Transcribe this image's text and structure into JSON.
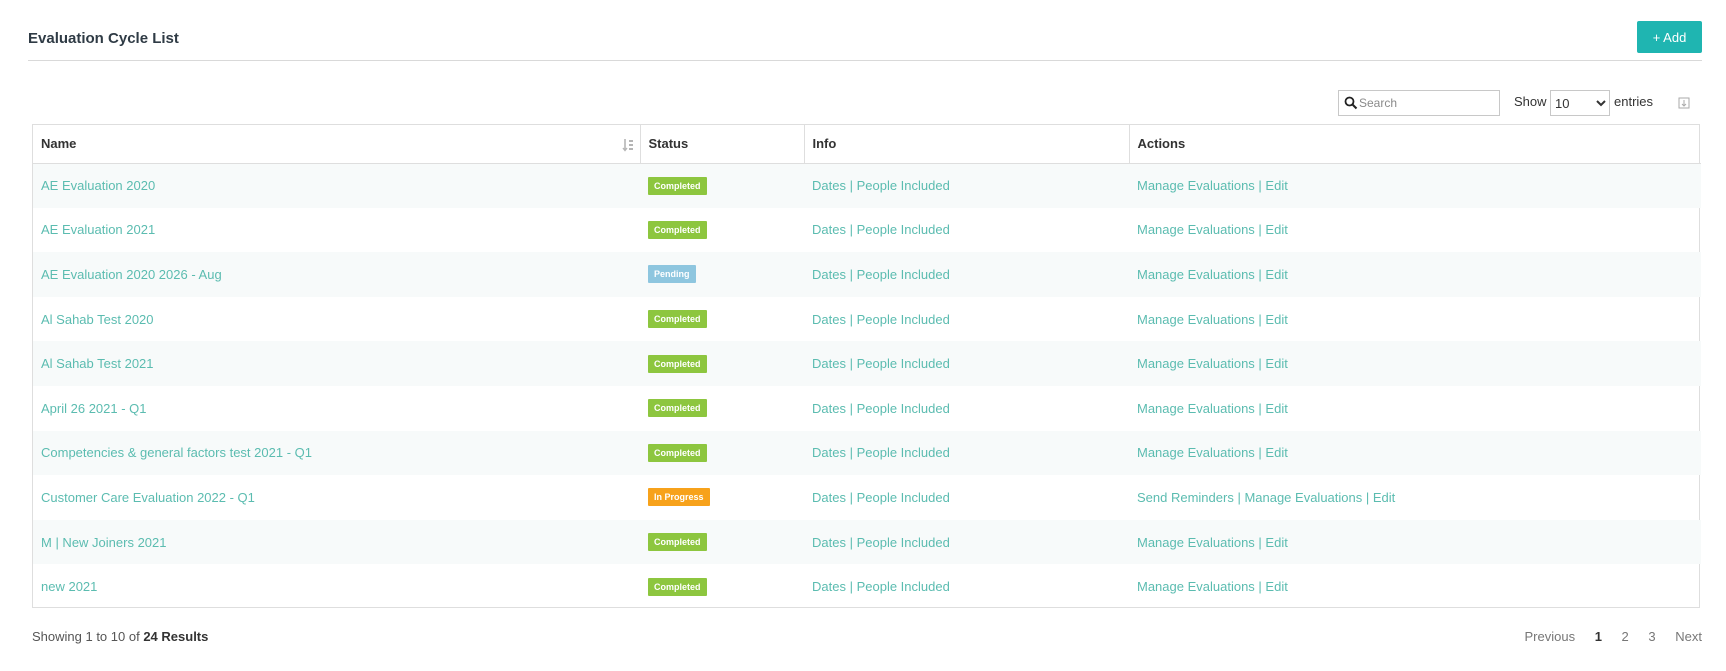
{
  "header": {
    "title": "Evaluation Cycle List",
    "add_label": "+ Add"
  },
  "toolbar": {
    "search_placeholder": "Search",
    "show_label": "Show",
    "entries_selected": "10",
    "entries_label": "entries"
  },
  "table": {
    "columns": [
      "Name",
      "Status",
      "Info",
      "Actions"
    ],
    "rows": [
      {
        "name": "AE Evaluation 2020",
        "status": "Completed",
        "status_color": "#8dc63f",
        "info": [
          "Dates",
          "People Included"
        ],
        "actions": [
          "Manage Evaluations",
          "Edit"
        ]
      },
      {
        "name": "AE Evaluation 2021",
        "status": "Completed",
        "status_color": "#8dc63f",
        "info": [
          "Dates",
          "People Included"
        ],
        "actions": [
          "Manage Evaluations",
          "Edit"
        ]
      },
      {
        "name": "AE Evaluation 2020 2026 - Aug",
        "status": "Pending",
        "status_color": "#8ec6df",
        "info": [
          "Dates",
          "People Included"
        ],
        "actions": [
          "Manage Evaluations",
          "Edit"
        ]
      },
      {
        "name": "Al Sahab Test 2020",
        "status": "Completed",
        "status_color": "#8dc63f",
        "info": [
          "Dates",
          "People Included"
        ],
        "actions": [
          "Manage Evaluations",
          "Edit"
        ]
      },
      {
        "name": "Al Sahab Test 2021",
        "status": "Completed",
        "status_color": "#8dc63f",
        "info": [
          "Dates",
          "People Included"
        ],
        "actions": [
          "Manage Evaluations",
          "Edit"
        ]
      },
      {
        "name": "April 26 2021 - Q1",
        "status": "Completed",
        "status_color": "#8dc63f",
        "info": [
          "Dates",
          "People Included"
        ],
        "actions": [
          "Manage Evaluations",
          "Edit"
        ]
      },
      {
        "name": "Competencies & general factors test 2021 - Q1",
        "status": "Completed",
        "status_color": "#8dc63f",
        "info": [
          "Dates",
          "People Included"
        ],
        "actions": [
          "Manage Evaluations",
          "Edit"
        ]
      },
      {
        "name": "Customer Care Evaluation 2022 - Q1",
        "status": "In Progress",
        "status_color": "#f7a21b",
        "info": [
          "Dates",
          "People Included"
        ],
        "actions": [
          "Send Reminders",
          "Manage Evaluations",
          "Edit"
        ]
      },
      {
        "name": "M | New Joiners 2021",
        "status": "Completed",
        "status_color": "#8dc63f",
        "info": [
          "Dates",
          "People Included"
        ],
        "actions": [
          "Manage Evaluations",
          "Edit"
        ]
      },
      {
        "name": "new 2021",
        "status": "Completed",
        "status_color": "#8dc63f",
        "info": [
          "Dates",
          "People Included"
        ],
        "actions": [
          "Manage Evaluations",
          "Edit"
        ]
      }
    ]
  },
  "footer": {
    "showing_prefix": "Showing 1 to 10 of",
    "results": "24 Results",
    "pagination": {
      "previous": "Previous",
      "pages": [
        "1",
        "2",
        "3"
      ],
      "current": "1",
      "next": "Next"
    }
  },
  "colors": {
    "accent": "#1fb5b1",
    "link": "#5bbcb0"
  },
  "icons": {
    "search": "search-icon",
    "sort": "sort-icon",
    "export": "export-icon"
  }
}
